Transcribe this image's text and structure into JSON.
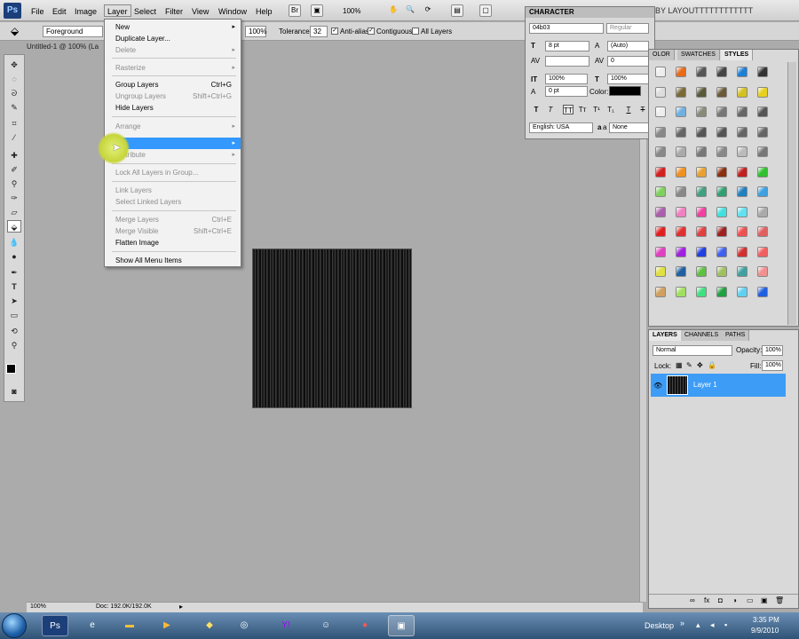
{
  "app": {
    "logo": "Ps",
    "window_title": "BY LAYOUTTTTTTTTTTTT"
  },
  "menubar": {
    "items": [
      "File",
      "Edit",
      "Image",
      "Layer",
      "Select",
      "Filter",
      "View",
      "Window",
      "Help"
    ],
    "zoom": "100%"
  },
  "options": {
    "fill": "Foreground",
    "opacity": "100%",
    "tolerance_label": "Tolerance:",
    "tolerance": "32",
    "antialias": "Anti-alias",
    "contiguous": "Contiguous",
    "all_layers": "All Layers"
  },
  "document": {
    "tab": "Untitled-1 @ 100% (La",
    "zoom": "100%",
    "doc_info": "Doc: 192.0K/192.0K"
  },
  "layer_menu": {
    "new": "New",
    "duplicate": "Duplicate Layer...",
    "delete": "Delete",
    "rasterize": "Rasterize",
    "group": "Group Layers",
    "group_sc": "Ctrl+G",
    "ungroup": "Ungroup Layers",
    "ungroup_sc": "Shift+Ctrl+G",
    "hide": "Hide Layers",
    "arrange": "Arrange",
    "distribute": "Distribute",
    "lock_all": "Lock All Layers in Group...",
    "link": "Link Layers",
    "select_linked": "Select Linked Layers",
    "merge": "Merge Layers",
    "merge_sc": "Ctrl+E",
    "merge_visible": "Merge Visible",
    "merge_visible_sc": "Shift+Ctrl+E",
    "flatten": "Flatten Image",
    "show_all": "Show All Menu Items"
  },
  "character": {
    "title": "CHARACTER",
    "font": "04b03",
    "style": "Regular",
    "size": "8 pt",
    "leading": "(Auto)",
    "kerning": "",
    "tracking": "0",
    "vscale": "100%",
    "hscale": "100%",
    "baseline": "0 pt",
    "color_label": "Color:",
    "language": "English: USA",
    "aa_label": "a",
    "aa": "None"
  },
  "styles_panel": {
    "tabs": [
      "OLOR",
      "SWATCHES",
      "STYLES"
    ]
  },
  "layers_panel": {
    "tabs": [
      "LAYERS",
      "CHANNELS",
      "PATHS"
    ],
    "blend": "Normal",
    "opacity_label": "Opacity:",
    "opacity": "100%",
    "lock_label": "Lock:",
    "fill_label": "Fill:",
    "fill": "100%",
    "layer_name": "Layer 1"
  },
  "taskbar": {
    "desktop": "Desktop",
    "time": "3:35 PM",
    "date": "9/9/2010"
  },
  "colors": {
    "highlight": "#3399ff",
    "layer_selected": "#3d9cf6"
  }
}
